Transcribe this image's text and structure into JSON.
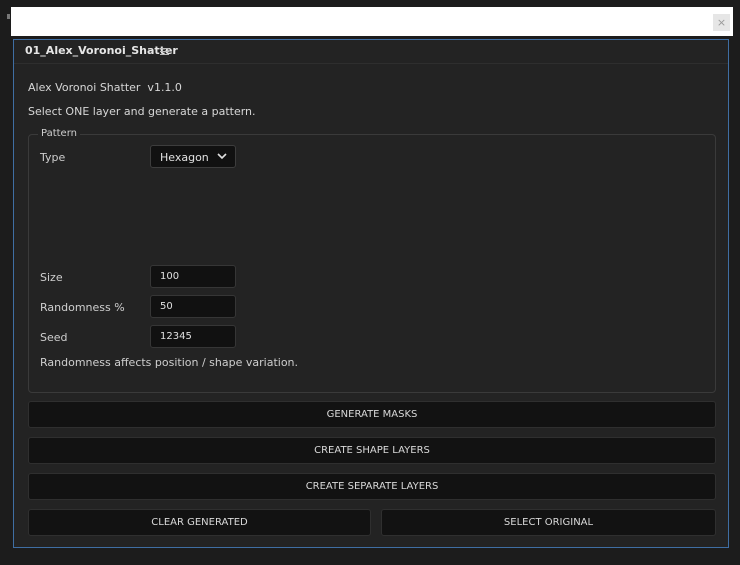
{
  "window": {
    "close_glyph": "×"
  },
  "panel": {
    "tab_title": "01_Alex_Voronoi_Shatter",
    "menu_icon": "hamburger-menu-icon"
  },
  "script": {
    "title": "Alex Voronoi Shatter  v1.1.0",
    "instruction": "Select ONE layer and generate a pattern."
  },
  "pattern": {
    "group_label": "Pattern",
    "type_label": "Type",
    "type_value": "Hexagon",
    "size_label": "Size",
    "size_value": "100",
    "randomness_label": "Randomness %",
    "randomness_value": "50",
    "seed_label": "Seed",
    "seed_value": "12345",
    "hint": "Randomness affects position / shape variation."
  },
  "buttons": {
    "generate_masks": "GENERATE MASKS",
    "create_shape_layers": "CREATE SHAPE LAYERS",
    "create_separate_layers": "CREATE SEPARATE LAYERS",
    "clear_generated": "CLEAR GENERATED",
    "select_original": "SELECT ORIGINAL"
  },
  "colors": {
    "panel_border": "#3f6ea3",
    "panel_bg": "#232323",
    "input_bg": "#111111",
    "button_bg": "#121212"
  }
}
